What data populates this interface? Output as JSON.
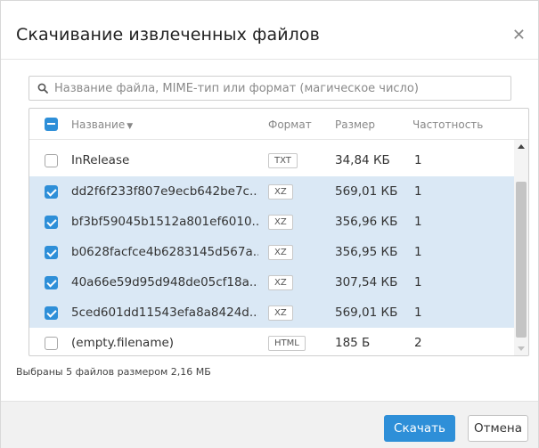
{
  "dialog": {
    "title": "Скачивание извлеченных файлов",
    "close_icon": "close-icon"
  },
  "search": {
    "icon": "search-icon",
    "placeholder": "Название файла, MIME-тип или формат (магическое число)",
    "value": ""
  },
  "table": {
    "header": {
      "select_all_state": "indeterminate",
      "name": "Название",
      "format": "Формат",
      "size": "Размер",
      "frequency": "Частотность"
    },
    "rows": [
      {
        "checked": false,
        "name": "InRelease",
        "format": "TXT",
        "size": "34,84 КБ",
        "frequency": "1"
      },
      {
        "checked": true,
        "name": "dd2f6f233f807e9ecb642be7c...",
        "format": "XZ",
        "size": "569,01 КБ",
        "frequency": "1"
      },
      {
        "checked": true,
        "name": "bf3bf59045b1512a801ef6010...",
        "format": "XZ",
        "size": "356,96 КБ",
        "frequency": "1"
      },
      {
        "checked": true,
        "name": "b0628facfce4b6283145d567a...",
        "format": "XZ",
        "size": "356,95 КБ",
        "frequency": "1"
      },
      {
        "checked": true,
        "name": "40a66e59d95d948de05cf18a...",
        "format": "XZ",
        "size": "307,54 КБ",
        "frequency": "1"
      },
      {
        "checked": true,
        "name": "5ced601dd11543efa8a8424d...",
        "format": "XZ",
        "size": "569,01 КБ",
        "frequency": "1"
      },
      {
        "checked": false,
        "name": "(empty.filename)",
        "format": "HTML",
        "size": "185 Б",
        "frequency": "2"
      }
    ]
  },
  "summary": "Выбраны 5 файлов размером 2,16 МБ",
  "footer": {
    "download_label": "Скачать",
    "cancel_label": "Отмена"
  },
  "colors": {
    "accent": "#2e8fd8",
    "selected_row": "#dae8f5"
  }
}
